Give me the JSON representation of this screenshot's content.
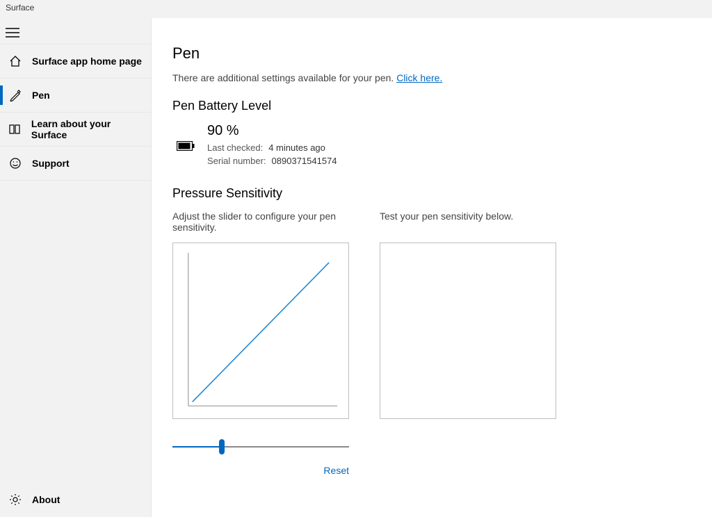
{
  "titlebar": "Surface",
  "sidebar": {
    "items": [
      {
        "label": "Surface app home page",
        "icon": "home"
      },
      {
        "label": "Pen",
        "icon": "pen",
        "selected": true
      },
      {
        "label": "Learn about your Surface",
        "icon": "book"
      },
      {
        "label": "Support",
        "icon": "smile"
      }
    ],
    "about_label": "About"
  },
  "main": {
    "title": "Pen",
    "subline_text": "There are additional settings available for your pen. ",
    "subline_link": "Click here.",
    "battery": {
      "heading": "Pen Battery Level",
      "percent": "90 %",
      "checked_k": "Last checked:",
      "checked_v": "4 minutes ago",
      "serial_k": "Serial number:",
      "serial_v": "0890371541574"
    },
    "pressure": {
      "heading": "Pressure Sensitivity",
      "adjust_hint": "Adjust the slider to configure your pen sensitivity.",
      "test_hint": "Test your pen sensitivity below.",
      "reset_label": "Reset",
      "slider_pct": 28
    }
  },
  "chart_data": {
    "type": "line",
    "title": "",
    "xlabel": "",
    "ylabel": "",
    "xlim": [
      0,
      1
    ],
    "ylim": [
      0,
      1
    ],
    "series": [
      {
        "name": "sensitivity-curve",
        "values": [
          [
            0,
            0
          ],
          [
            1,
            1
          ]
        ]
      }
    ]
  }
}
